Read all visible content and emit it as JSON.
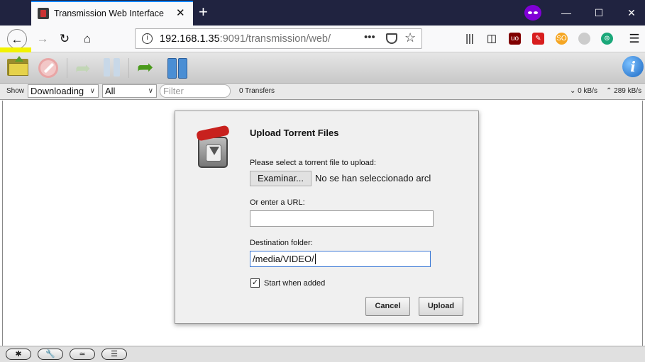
{
  "browser": {
    "tab_title": "Transmission Web Interface",
    "tab_close": "✕",
    "new_tab": "+",
    "window_controls": {
      "minimize": "—",
      "maximize": "☐",
      "close": "✕"
    },
    "url_prefix": "192.168.1.35",
    "url_suffix": ":9091/transmission/web/",
    "page_actions": "•••",
    "menu": "☰"
  },
  "toolbar": {
    "info_label": "i"
  },
  "filterbar": {
    "show_label": "Show",
    "state_filter": "Downloading",
    "tracker_filter": "All",
    "filter_placeholder": "Filter",
    "transfers": "0 Transfers",
    "down_speed": "0 kB/s",
    "up_speed": "289 kB/s"
  },
  "dialog": {
    "title": "Upload Torrent Files",
    "select_label": "Please select a torrent file to upload:",
    "browse_button": "Examinar...",
    "no_file_text": "No se han seleccionado arcl",
    "url_label": "Or enter a URL:",
    "url_value": "",
    "dest_label": "Destination folder:",
    "dest_value": "/media/VIDEO/",
    "start_label": "Start when added",
    "start_checked": true,
    "cancel_button": "Cancel",
    "upload_button": "Upload"
  },
  "bottombar": {
    "settings": "✱",
    "preferences": "🔧",
    "turtle": "≃",
    "sort": "☰"
  },
  "colors": {
    "highlight": "#f2f200",
    "titlebar": "#202340",
    "accent": "#0a84ff"
  }
}
